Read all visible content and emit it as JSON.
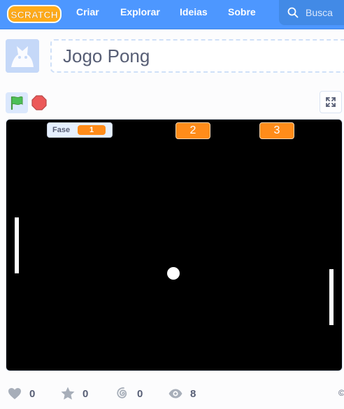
{
  "app": {
    "logo_text": "SCRATCH"
  },
  "nav": {
    "items": [
      {
        "label": "Criar"
      },
      {
        "label": "Explorar"
      },
      {
        "label": "Ideias"
      },
      {
        "label": "Sobre"
      }
    ],
    "search": {
      "placeholder": "Busca"
    }
  },
  "project": {
    "title": "Jogo Pong",
    "stage": {
      "variable_monitor": {
        "label": "Fase",
        "value": "1"
      },
      "level_buttons": [
        "2",
        "3"
      ]
    }
  },
  "stats": {
    "loves": "0",
    "favorites": "0",
    "remixes": "0",
    "views": "8",
    "copyright": "©"
  },
  "colors": {
    "nav_blue": "#4d97ff",
    "variable_orange": "#ff8c1a",
    "stage_black": "#000000",
    "text_gray": "#575e75"
  },
  "icons": [
    "scratch-logo",
    "search-icon",
    "green-flag-icon",
    "stop-icon",
    "fullscreen-icon",
    "heart-icon",
    "star-icon",
    "remix-icon",
    "eye-icon"
  ]
}
